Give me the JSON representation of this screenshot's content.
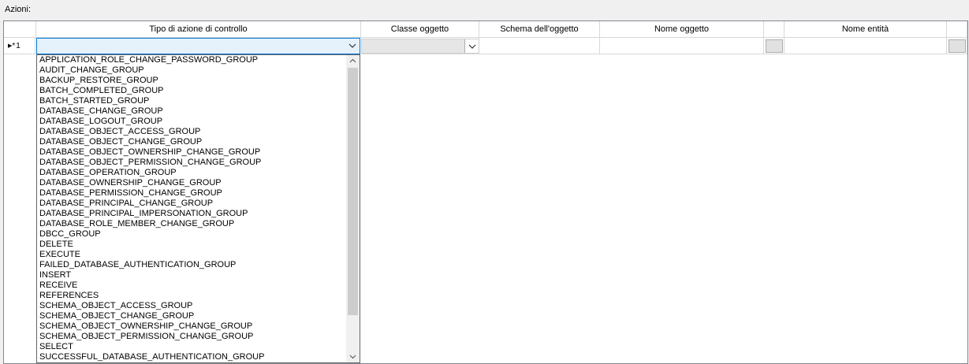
{
  "section": {
    "label": "Azioni:"
  },
  "columns": [
    {
      "label": ""
    },
    {
      "label": "Tipo di azione di controllo"
    },
    {
      "label": "Classe oggetto"
    },
    {
      "label": "Schema dell'oggetto"
    },
    {
      "label": "Nome oggetto"
    },
    {
      "label": ""
    },
    {
      "label": "Nome entità"
    },
    {
      "label": ""
    }
  ],
  "row": {
    "number": "1"
  },
  "dropdown": {
    "items": [
      "APPLICATION_ROLE_CHANGE_PASSWORD_GROUP",
      "AUDIT_CHANGE_GROUP",
      "BACKUP_RESTORE_GROUP",
      "BATCH_COMPLETED_GROUP",
      "BATCH_STARTED_GROUP",
      "DATABASE_CHANGE_GROUP",
      "DATABASE_LOGOUT_GROUP",
      "DATABASE_OBJECT_ACCESS_GROUP",
      "DATABASE_OBJECT_CHANGE_GROUP",
      "DATABASE_OBJECT_OWNERSHIP_CHANGE_GROUP",
      "DATABASE_OBJECT_PERMISSION_CHANGE_GROUP",
      "DATABASE_OPERATION_GROUP",
      "DATABASE_OWNERSHIP_CHANGE_GROUP",
      "DATABASE_PERMISSION_CHANGE_GROUP",
      "DATABASE_PRINCIPAL_CHANGE_GROUP",
      "DATABASE_PRINCIPAL_IMPERSONATION_GROUP",
      "DATABASE_ROLE_MEMBER_CHANGE_GROUP",
      "DBCC_GROUP",
      "DELETE",
      "EXECUTE",
      "FAILED_DATABASE_AUTHENTICATION_GROUP",
      "INSERT",
      "RECEIVE",
      "REFERENCES",
      "SCHEMA_OBJECT_ACCESS_GROUP",
      "SCHEMA_OBJECT_CHANGE_GROUP",
      "SCHEMA_OBJECT_OWNERSHIP_CHANGE_GROUP",
      "SCHEMA_OBJECT_PERMISSION_CHANGE_GROUP",
      "SELECT",
      "SUCCESSFUL_DATABASE_AUTHENTICATION_GROUP"
    ]
  },
  "colors": {
    "focus_border": "#0078d7",
    "selected_fill": "#e5f1fb",
    "grid_line": "#d8d8d8",
    "scroll_thumb": "#cdcdcd"
  }
}
